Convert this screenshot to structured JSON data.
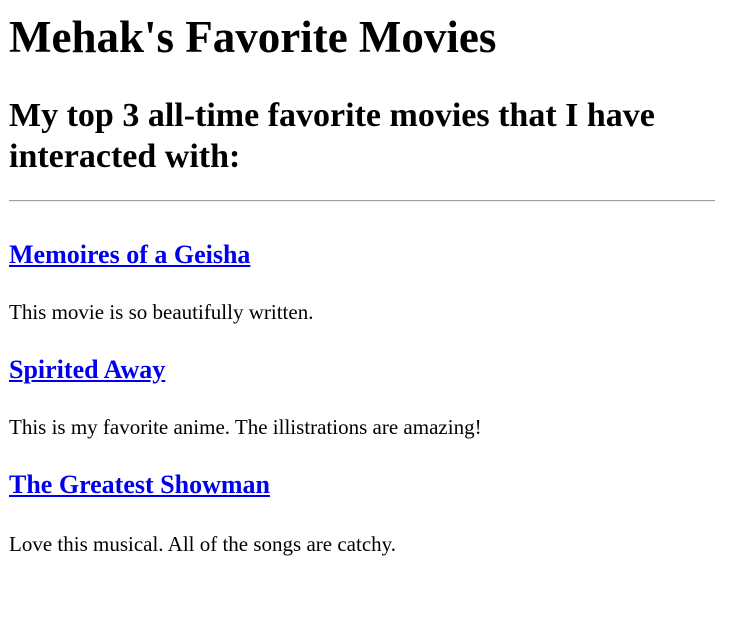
{
  "page": {
    "title": "Mehak's Favorite Movies",
    "subtitle": "My top 3 all-time favorite movies that I have interacted with:"
  },
  "movies": [
    {
      "title": "Memoires of a Geisha",
      "description": "This movie is so beautifully written."
    },
    {
      "title": "Spirited Away",
      "description": "This is my favorite anime. The illistrations are amazing!"
    },
    {
      "title": "The Greatest Showman",
      "description": "Love this musical. All of the songs are catchy."
    }
  ],
  "colors": {
    "link": "#0000ee",
    "text": "#000000",
    "background": "#ffffff",
    "divider": "#a0a0a0"
  }
}
